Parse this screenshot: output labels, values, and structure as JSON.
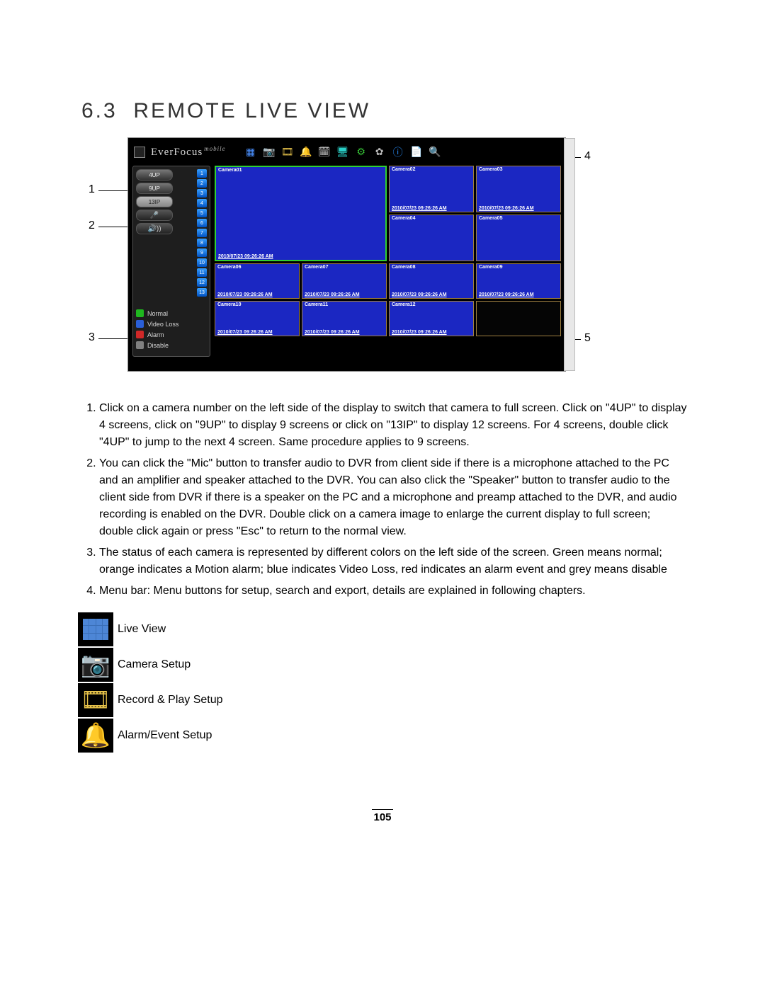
{
  "section": {
    "number": "6.3",
    "title": "REMOTE LIVE VIEW"
  },
  "app": {
    "brand": "EverFocus",
    "brand_sup": "mobile",
    "menu_icons": [
      "live-view-icon",
      "camera-icon",
      "record-icon",
      "alarm-icon",
      "schedule-icon",
      "display-icon",
      "network-icon",
      "settings-icon",
      "info-icon",
      "log-icon",
      "search-icon"
    ],
    "up_buttons": [
      "4UP",
      "9UP",
      "13IP"
    ],
    "mic_label": "🎤",
    "speaker_label": "🔊))",
    "cam_numbers": [
      "1",
      "2",
      "3",
      "4",
      "5",
      "6",
      "7",
      "8",
      "9",
      "10",
      "11",
      "12",
      "13"
    ],
    "legend": [
      {
        "color": "#1fb81f",
        "label": "Normal"
      },
      {
        "color": "#2a5fd8",
        "label": "Video Loss"
      },
      {
        "color": "#d02828",
        "label": "Alarm"
      },
      {
        "color": "#808080",
        "label": "Disable"
      }
    ],
    "cameras": [
      {
        "name": "Camera01",
        "time": "2010/07/23  09:26:26 AM",
        "main": true
      },
      {
        "name": "Camera02",
        "time": "2010/07/23  09:26:26 AM"
      },
      {
        "name": "Camera03",
        "time": "2010/07/23  09:26:26 AM"
      },
      {
        "name": "Camera04",
        "time": ""
      },
      {
        "name": "Camera05",
        "time": ""
      },
      {
        "name": "Camera06",
        "time": "2010/07/23  09:26:26 AM"
      },
      {
        "name": "Camera07",
        "time": "2010/07/23  09:26:26 AM"
      },
      {
        "name": "Camera08",
        "time": "2010/07/23  09:26:26 AM"
      },
      {
        "name": "Camera09",
        "time": "2010/07/23  09:26:26 AM"
      },
      {
        "name": "Camera10",
        "time": "2010/07/23  09:26:26 AM"
      },
      {
        "name": "Camera11",
        "time": "2010/07/23  09:26:26 AM"
      },
      {
        "name": "Camera12",
        "time": "2010/07/23  09:26:26 AM"
      },
      {
        "name": "",
        "time": "",
        "blank": true
      }
    ]
  },
  "callouts": {
    "c1": "1",
    "c2": "2",
    "c3": "3",
    "c4": "4",
    "c5": "5"
  },
  "instructions": [
    "Click on a camera number on the left side of the display to switch that camera to full screen. Click on \"4UP\" to display 4 screens, click on \"9UP\" to display 9 screens or click on \"13IP\" to display 12 screens. For 4 screens, double click \"4UP\" to jump to the next 4 screen. Same procedure applies to 9 screens.",
    "You can click the \"Mic\" button to transfer audio to DVR from client side if there is a microphone attached to the PC and an amplifier and speaker attached to the DVR. You can also click the \"Speaker\" button to transfer audio to the client side from DVR if there is a speaker on the PC and a microphone and preamp attached to the DVR, and audio recording is enabled on the DVR. Double click on a camera image to enlarge the current display to full screen; double click again or press \"Esc\" to return to the normal view.",
    "The status of each camera is represented by different colors on the left side of the screen. Green means normal; orange indicates a Motion alarm; blue indicates Video Loss, red indicates an alarm event and grey means disable",
    "Menu bar: Menu buttons for setup, search and export, details are explained in following chapters."
  ],
  "icon_list": [
    {
      "label": "Live View"
    },
    {
      "label": "Camera Setup"
    },
    {
      "label": "Record & Play Setup"
    },
    {
      "label": "Alarm/Event Setup"
    }
  ],
  "page_number": "105"
}
